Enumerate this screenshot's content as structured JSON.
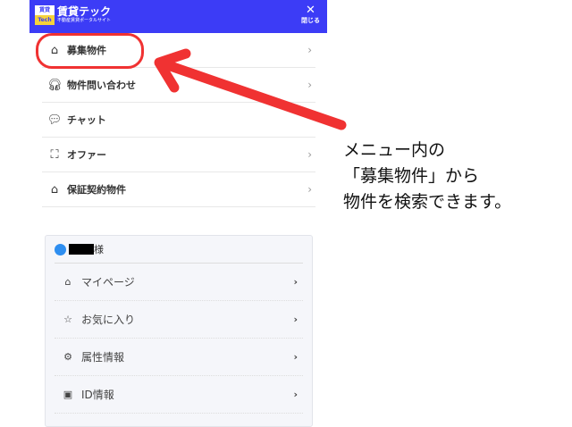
{
  "header": {
    "logo_top": "賃貸",
    "logo_bottom": "Tech",
    "title": "賃貸テック",
    "subtitle": "不動産賃貸ポータルサイト",
    "close_label": "閉じる"
  },
  "menu": [
    {
      "label": "募集物件",
      "icon": "house-search-icon",
      "chevron": true
    },
    {
      "label": "物件問い合わせ",
      "icon": "headset-icon",
      "chevron": true
    },
    {
      "label": "チャット",
      "icon": "chat-icon",
      "chevron": false
    },
    {
      "label": "オファー",
      "icon": "frame-icon",
      "chevron": true
    },
    {
      "label": "保証契約物件",
      "icon": "house-check-icon",
      "chevron": true
    }
  ],
  "account": {
    "suffix": "様",
    "items": [
      {
        "label": "マイページ",
        "icon": "home-icon"
      },
      {
        "label": "お気に入り",
        "icon": "star-icon"
      },
      {
        "label": "属性情報",
        "icon": "gear-icon"
      },
      {
        "label": "ID情報",
        "icon": "id-card-icon"
      }
    ]
  },
  "annotation": {
    "lines": [
      "メニュー内の",
      "「募集物件」から",
      "物件を検索できます。"
    ],
    "color": "#f03232"
  }
}
